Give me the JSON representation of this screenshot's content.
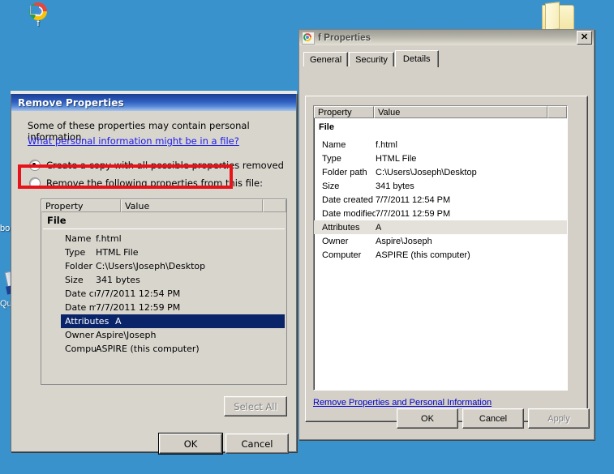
{
  "desktop": {
    "background_color": "#3a92cd",
    "icons": [
      {
        "name": "f",
        "label": "f",
        "type": "chrome-html-file"
      },
      {
        "name": "bo",
        "label": "bo",
        "type": "clipped-icon"
      },
      {
        "name": "Qu",
        "label": "Qu",
        "type": "clipped-icon"
      },
      {
        "name": "folder",
        "label": "",
        "type": "folder"
      }
    ]
  },
  "remove_dialog": {
    "title": "Remove Properties",
    "info_text": "Some of these properties may contain personal information.",
    "help_link": "What personal information might be in a file?",
    "options": [
      {
        "label": "Create a copy with all possible properties removed",
        "selected": true
      },
      {
        "label": "Remove the following properties from this file:",
        "selected": false
      }
    ],
    "table": {
      "headers": [
        "Property",
        "Value"
      ],
      "group_label": "File",
      "rows": [
        {
          "property": "Name",
          "value": "f.html",
          "selected": false
        },
        {
          "property": "Type",
          "value": "HTML File",
          "selected": false
        },
        {
          "property": "Folder path",
          "value": "C:\\Users\\Joseph\\Desktop",
          "selected": false
        },
        {
          "property": "Size",
          "value": "341 bytes",
          "selected": false
        },
        {
          "property": "Date created",
          "value": "7/7/2011 12:54 PM",
          "selected": false
        },
        {
          "property": "Date modified",
          "value": "7/7/2011 12:59 PM",
          "selected": false
        },
        {
          "property": "Attributes",
          "value": "A",
          "selected": true
        },
        {
          "property": "Owner",
          "value": "Aspire\\Joseph",
          "selected": false
        },
        {
          "property": "Computer",
          "value": "ASPIRE (this computer)",
          "selected": false
        }
      ]
    },
    "buttons": {
      "select_all": "Select All",
      "ok": "OK",
      "cancel": "Cancel"
    },
    "highlight_color": "#e8131a"
  },
  "properties_dialog": {
    "title": "f Properties",
    "close_label": "✕",
    "tabs": [
      {
        "label": "General",
        "active": false
      },
      {
        "label": "Security",
        "active": false
      },
      {
        "label": "Details",
        "active": true
      }
    ],
    "table": {
      "headers": [
        "Property",
        "Value",
        ""
      ],
      "group_label": "File",
      "rows": [
        {
          "property": "Name",
          "value": "f.html",
          "selected": false
        },
        {
          "property": "Type",
          "value": "HTML File",
          "selected": false
        },
        {
          "property": "Folder path",
          "value": "C:\\Users\\Joseph\\Desktop",
          "selected": false
        },
        {
          "property": "Size",
          "value": "341 bytes",
          "selected": false
        },
        {
          "property": "Date created",
          "value": "7/7/2011 12:54 PM",
          "selected": false
        },
        {
          "property": "Date modified",
          "value": "7/7/2011 12:59 PM",
          "selected": false
        },
        {
          "property": "Attributes",
          "value": "A",
          "selected": true
        },
        {
          "property": "Owner",
          "value": "Aspire\\Joseph",
          "selected": false
        },
        {
          "property": "Computer",
          "value": "ASPIRE (this computer)",
          "selected": false
        }
      ]
    },
    "link": "Remove Properties and Personal Information",
    "buttons": {
      "ok": "OK",
      "cancel": "Cancel",
      "apply": "Apply",
      "apply_disabled": true
    }
  }
}
